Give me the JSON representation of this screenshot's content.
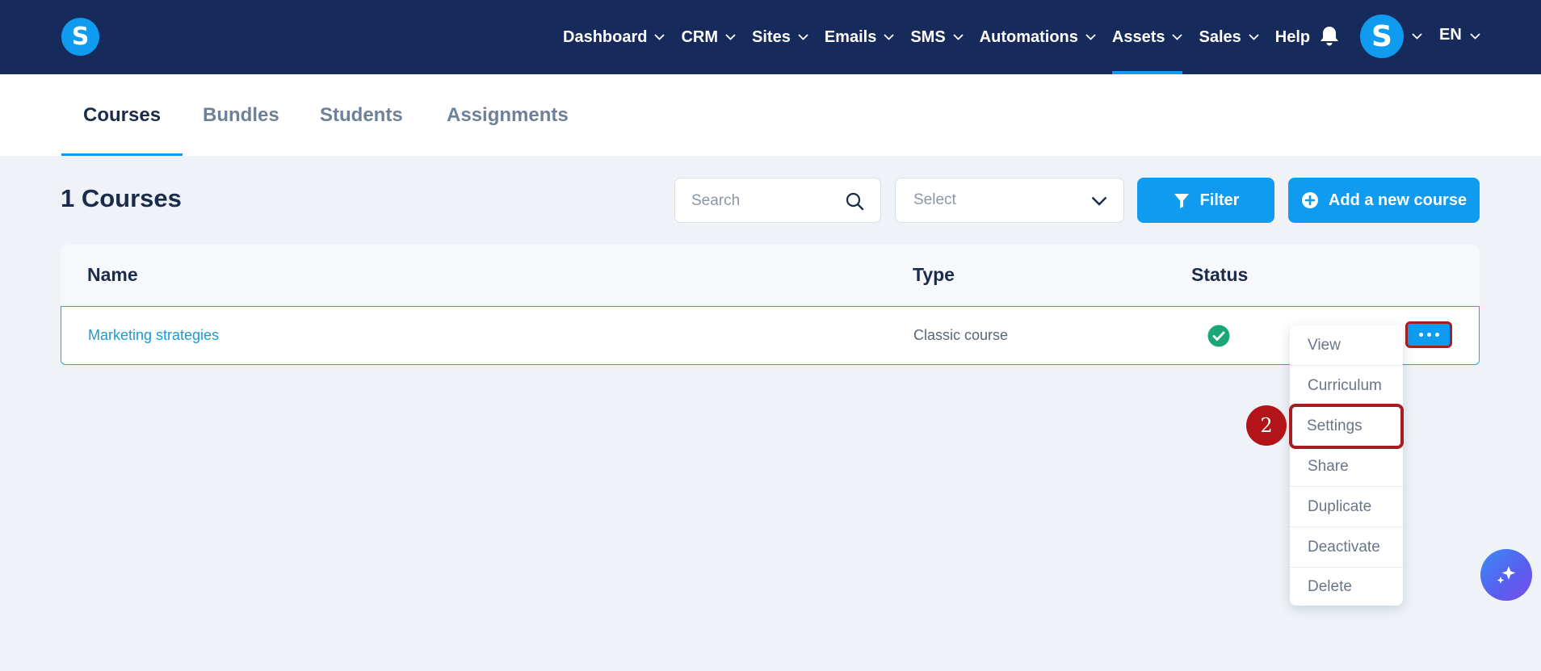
{
  "brand": {
    "logo_letter": "S",
    "accent": "#0e9bf0",
    "navbar_bg": "#162b5c"
  },
  "nav": {
    "items": [
      {
        "label": "Dashboard",
        "has_dropdown": true
      },
      {
        "label": "CRM",
        "has_dropdown": true
      },
      {
        "label": "Sites",
        "has_dropdown": true
      },
      {
        "label": "Emails",
        "has_dropdown": true
      },
      {
        "label": "SMS",
        "has_dropdown": true
      },
      {
        "label": "Automations",
        "has_dropdown": true
      },
      {
        "label": "Assets",
        "has_dropdown": true,
        "active": true
      },
      {
        "label": "Sales",
        "has_dropdown": true
      },
      {
        "label": "Help",
        "has_dropdown": false
      }
    ],
    "avatar_letter": "S",
    "language": "EN"
  },
  "subtabs": [
    {
      "label": "Courses",
      "active": true
    },
    {
      "label": "Bundles"
    },
    {
      "label": "Students"
    },
    {
      "label": "Assignments"
    }
  ],
  "page": {
    "title": "1 Courses",
    "search_placeholder": "Search",
    "select_value": "Select",
    "filter_label": "Filter",
    "add_label": "Add a new course"
  },
  "table": {
    "columns": [
      "Name",
      "Type",
      "Status"
    ],
    "rows": [
      {
        "name": "Marketing strategies",
        "type": "Classic course",
        "status": "active"
      }
    ]
  },
  "row_menu": {
    "items": [
      "View",
      "Curriculum",
      "Settings",
      "Share",
      "Duplicate",
      "Deactivate",
      "Delete"
    ],
    "highlighted": "Settings"
  },
  "annotation": {
    "step": "2"
  },
  "colors": {
    "status_ok": "#1aa77a",
    "highlight_border": "#a51e22"
  },
  "icons": [
    "logo",
    "chevron-down-icon",
    "bell-icon",
    "search-icon",
    "filter-icon",
    "plus-circle-icon",
    "check-circle-icon",
    "more-icon",
    "sparkles-icon"
  ]
}
